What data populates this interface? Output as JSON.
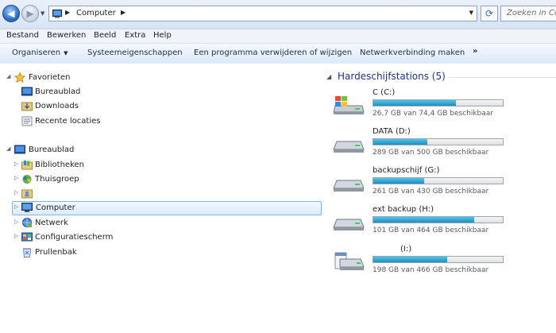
{
  "address_bar": {
    "path": "Computer",
    "search_placeholder": "Zoeken in Computer"
  },
  "menu": [
    "Bestand",
    "Bewerken",
    "Beeld",
    "Extra",
    "Help"
  ],
  "toolbar": {
    "organize_label": "Organiseren",
    "system_properties_label": "Systeemeigenschappen",
    "uninstall_label": "Een programma verwijderen of wijzigen",
    "map_drive_label": "Netwerkverbinding maken",
    "more_label": "»"
  },
  "nav": {
    "favorites": {
      "label": "Favorieten",
      "items": [
        "Bureaublad",
        "Downloads",
        "Recente locaties"
      ]
    },
    "desktop": {
      "label": "Bureaublad",
      "items": [
        "Bibliotheken",
        "Thuisgroep",
        "",
        "Computer",
        "Netwerk",
        "Configuratiescherm",
        "Prullenbak"
      ]
    }
  },
  "content": {
    "group_title": "Hardeschijfstations (5)",
    "drives": [
      {
        "name": "C (C:)",
        "size_text": "26,7 GB van 74,4 GB beschikbaar",
        "used_fraction": 0.64,
        "icon": "windows-drive-icon"
      },
      {
        "name": "DATA (D:)",
        "size_text": "289 GB van 500 GB beschikbaar",
        "used_fraction": 0.42,
        "icon": "hard-drive-icon"
      },
      {
        "name": "backupschijf (G:)",
        "size_text": "261 GB van 430 GB beschikbaar",
        "used_fraction": 0.39,
        "icon": "hard-drive-icon"
      },
      {
        "name": "ext backup (H:)",
        "size_text": "101 GB van 464 GB beschikbaar",
        "used_fraction": 0.78,
        "icon": "hard-drive-icon"
      },
      {
        "name": "(I:)",
        "size_text": "198 GB van 466 GB beschikbaar",
        "used_fraction": 0.57,
        "icon": "hard-drive-icon"
      }
    ]
  },
  "colors": {
    "accent": "#1e3287",
    "selection": "#dbeafd",
    "progress": "#26a0da"
  }
}
